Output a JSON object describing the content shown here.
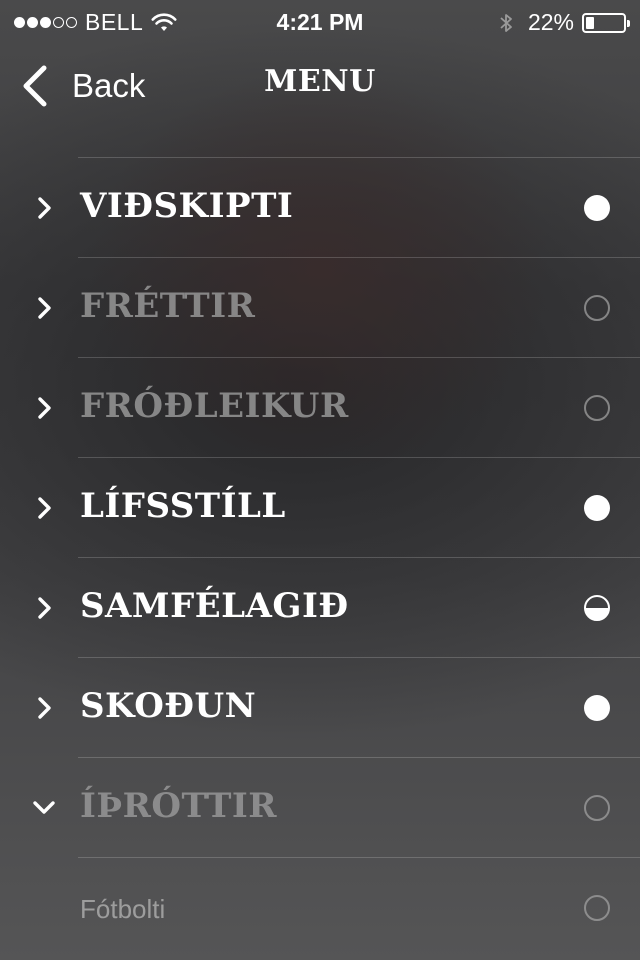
{
  "status_bar": {
    "carrier": "BELL",
    "signal_bars_filled": 3,
    "signal_bars_total": 5,
    "time": "4:21 PM",
    "battery_percent": "22%",
    "battery_level": 0.22
  },
  "nav": {
    "back_label": "Back",
    "title": "MENU"
  },
  "menu": {
    "items": [
      {
        "label": "VIÐSKIPTI",
        "state": "full",
        "expanded": false,
        "dimmed": false
      },
      {
        "label": "FRÉTTIR",
        "state": "empty",
        "expanded": false,
        "dimmed": true
      },
      {
        "label": "FRÓÐLEIKUR",
        "state": "empty",
        "expanded": false,
        "dimmed": true
      },
      {
        "label": "LÍFSSTÍLL",
        "state": "full",
        "expanded": false,
        "dimmed": false
      },
      {
        "label": "SAMFÉLAGIÐ",
        "state": "half",
        "expanded": false,
        "dimmed": false
      },
      {
        "label": "SKOÐUN",
        "state": "full",
        "expanded": false,
        "dimmed": false
      },
      {
        "label": "ÍÞRÓTTIR",
        "state": "empty",
        "expanded": true,
        "dimmed": true
      },
      {
        "label": "Fótbolti",
        "state": "empty",
        "subitem": true,
        "dimmed": true
      }
    ]
  }
}
